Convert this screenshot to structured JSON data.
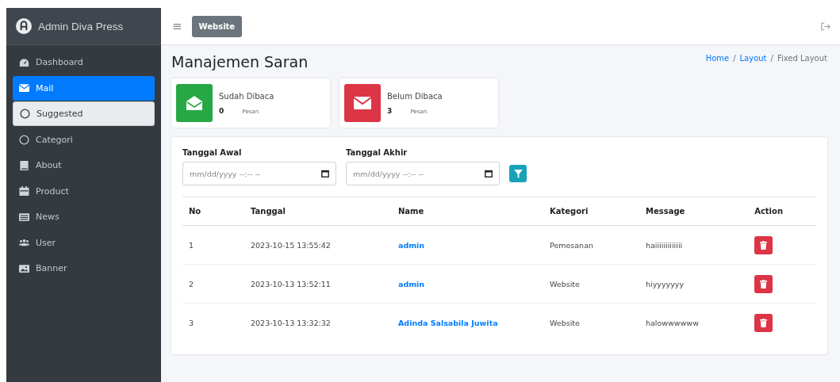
{
  "brand": {
    "title": "Admin Diva Press"
  },
  "sidebar": {
    "items": [
      {
        "label": "Dashboard",
        "selected": false
      },
      {
        "label": "Mail",
        "selected": true,
        "children": [
          {
            "label": "Suggested",
            "selected": true
          },
          {
            "label": "Categori",
            "selected": false
          }
        ]
      },
      {
        "label": "About",
        "selected": false
      },
      {
        "label": "Product",
        "selected": false
      },
      {
        "label": "News",
        "selected": false
      },
      {
        "label": "User",
        "selected": false
      },
      {
        "label": "Banner",
        "selected": false
      }
    ]
  },
  "navbar": {
    "menu": "≡",
    "website_button": "Website"
  },
  "page": {
    "title": "Manajemen Saran",
    "breadcrumb": [
      {
        "label": "Home",
        "link": true
      },
      {
        "separator": "/",
        "label": "Layout",
        "link": true
      },
      {
        "separator": "/",
        "label": "Fixed Layout",
        "link": false
      }
    ]
  },
  "stats": [
    {
      "label": "Sudah Dibaca",
      "count": "0",
      "unit": "Pesan",
      "kind": "read",
      "color": "#28a745"
    },
    {
      "label": "Belum Dibaca",
      "count": "3",
      "unit": "Pesan",
      "kind": "unread",
      "color": "#dc3545"
    }
  ],
  "filter": {
    "fields": [
      {
        "label": "Tanggal Awal",
        "placeholder": "mm/dd/yyyy --:-- --"
      },
      {
        "label": "Tanggal Akhir",
        "placeholder": "mm/dd/yyyy --:-- --"
      }
    ]
  },
  "table": {
    "columns": [
      "No",
      "Tanggal",
      "Name",
      "Kategori",
      "Message",
      "Action"
    ],
    "rows": [
      {
        "no": "1",
        "tanggal": "2023-10-15 13:55:42",
        "name": "admin",
        "kategori": "Pemesanan",
        "message": "haiiiiiiiiiiiii"
      },
      {
        "no": "2",
        "tanggal": "2023-10-13 13:52:11",
        "name": "admin",
        "kategori": "Website",
        "message": "hiyyyyyyy"
      },
      {
        "no": "3",
        "tanggal": "2023-10-13 13:32:32",
        "name": "Adinda Salsabila Juwita",
        "kategori": "Website",
        "message": "halowwwwww"
      }
    ]
  }
}
